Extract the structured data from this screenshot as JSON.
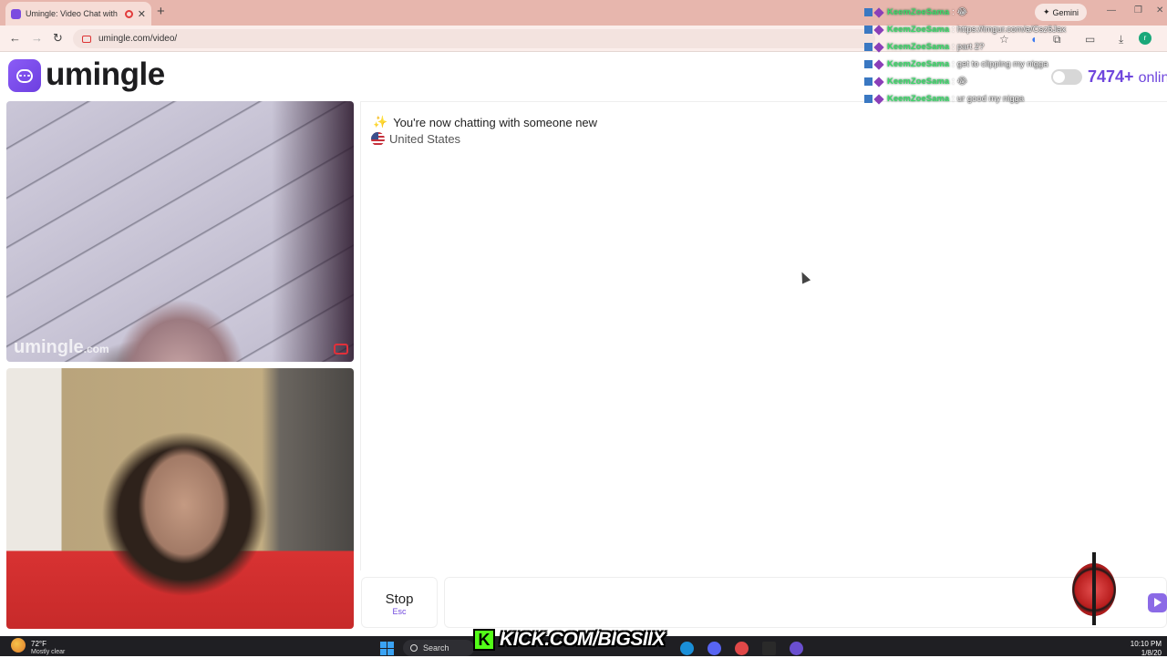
{
  "browser": {
    "tab_title": "Umingle: Video Chat with S",
    "tab_close": "✕",
    "new_tab": "+",
    "gemini_label": "Gemini",
    "url": "umingle.com/video/",
    "nav": {
      "back": "←",
      "forward": "→",
      "reload": "↻"
    },
    "window_controls": {
      "minimize": "—",
      "restore": "❐",
      "close": "✕"
    }
  },
  "site": {
    "logo_text": "umingle",
    "online_count": "7474+",
    "online_label": "onlin",
    "accent_color": "#6f46dd"
  },
  "video": {
    "watermark_brand": "umingle",
    "watermark_tld": ".com"
  },
  "chat": {
    "status_message": "You're now chatting with someone new",
    "country": "United States"
  },
  "controls": {
    "stop_label": "Stop",
    "stop_key": "Esc",
    "message_value": ""
  },
  "stream_chat": [
    {
      "user": "KeemZoeSama",
      "text": "😂"
    },
    {
      "user": "KeemZoeSama",
      "text": "https://imgur.com/a/Csz6Jax"
    },
    {
      "user": "KeemZoeSama",
      "text": "part 2?"
    },
    {
      "user": "KeemZoeSama",
      "text": "get to clipping my nigga"
    },
    {
      "user": "KeemZoeSama",
      "text": "😂"
    },
    {
      "user": "KeemZoeSama",
      "text": "ur good my nigga"
    }
  ],
  "overlay": {
    "kick_url": "KICK.COM/BIGSIIX"
  },
  "taskbar": {
    "temperature": "72°F",
    "condition": "Mostly clear",
    "search_label": "Search",
    "time": "10:10 PM",
    "date": "1/8/20"
  }
}
